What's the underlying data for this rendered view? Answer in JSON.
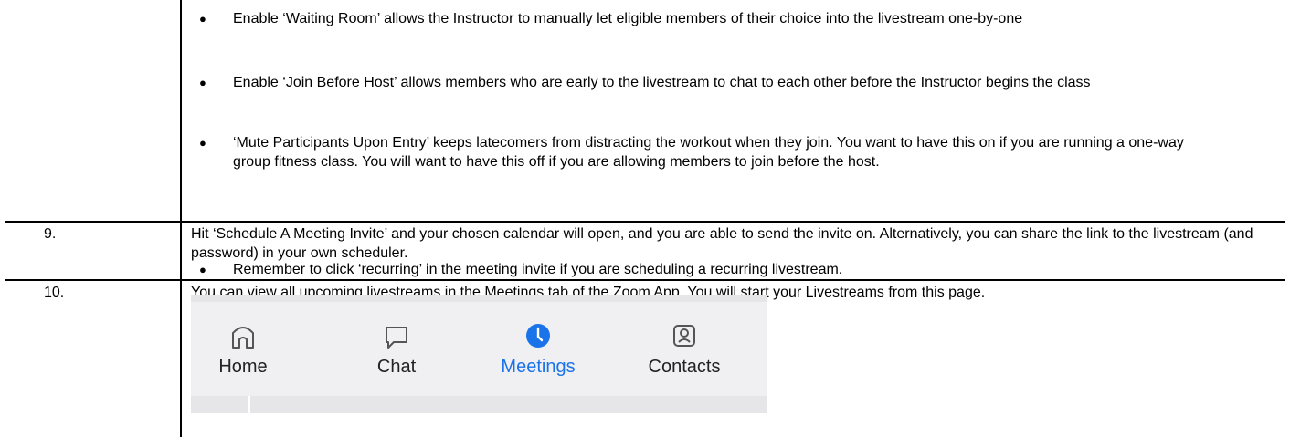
{
  "row_continued": {
    "bullets": [
      "Enable ‘Waiting Room’ allows the Instructor to manually let eligible members of their choice into the livestream one-by-one",
      "Enable ‘Join Before Host’ allows members who are early to the livestream to chat to each other before the Instructor begins the class",
      "‘Mute Participants Upon Entry’ keeps latecomers from distracting the workout when they join. You want to have this on if you are running a one-way group fitness class. You will want to have this off if you are allowing members to join before the host."
    ]
  },
  "step9": {
    "number": "9.",
    "text": "Hit ‘Schedule A Meeting Invite’ and your chosen calendar will open, and you are able to send the invite on. Alternatively, you can share the link to the livestream (and password) in your own scheduler.",
    "bullet": "Remember to click ‘recurring’ in the meeting invite if you are scheduling a recurring livestream."
  },
  "step10": {
    "number": "10.",
    "text": "You can view all upcoming livestreams in the Meetings tab of the Zoom App. You will start your Livestreams from this page."
  },
  "zoom_nav": {
    "items": [
      {
        "label": "Home",
        "icon": "home-icon",
        "active": false
      },
      {
        "label": "Chat",
        "icon": "chat-icon",
        "active": false
      },
      {
        "label": "Meetings",
        "icon": "clock-icon",
        "active": true
      },
      {
        "label": "Contacts",
        "icon": "contacts-icon",
        "active": false
      }
    ],
    "active_color": "#1a73e8",
    "icon_color": "#555555"
  }
}
